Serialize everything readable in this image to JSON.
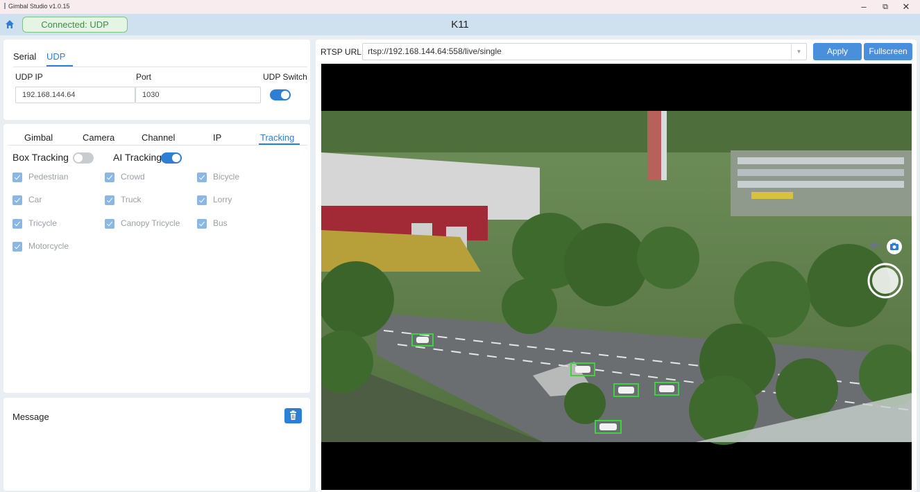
{
  "window": {
    "title": "Gimbal Studio v1.0.15",
    "controls": {
      "minimize": "–",
      "restore": "⧉",
      "close": "✕"
    }
  },
  "header": {
    "connection_status": "Connected: UDP",
    "device_name": "K11"
  },
  "connection": {
    "tabs": [
      "Serial",
      "UDP"
    ],
    "active_tab": "UDP",
    "udp_ip_label": "UDP IP",
    "udp_ip_value": "192.168.144.64",
    "port_label": "Port",
    "port_value": "1030",
    "udp_switch_label": "UDP Switch",
    "udp_switch_on": true
  },
  "control": {
    "tabs": [
      "Gimbal",
      "Camera",
      "Channel",
      "IP",
      "Tracking"
    ],
    "active_tab": "Tracking",
    "box_tracking_label": "Box Tracking",
    "box_tracking_on": false,
    "ai_tracking_label": "AI Tracking",
    "ai_tracking_on": true,
    "targets": [
      "Pedestrian",
      "Crowd",
      "Bicycle",
      "Car",
      "Truck",
      "Lorry",
      "Tricycle",
      "Canopy Tricycle",
      "Bus",
      "Motorcycle"
    ]
  },
  "message": {
    "title": "Message"
  },
  "video": {
    "rtsp_label": "RTSP URL:",
    "rtsp_url": "rtsp://192.168.144.64:558/live/single",
    "apply_label": "Apply",
    "fullscreen_label": "Fullscreen"
  },
  "colors": {
    "accent": "#2e7fd3",
    "connected_green": "#3f8f3f",
    "detection_box": "#3fd23f"
  }
}
